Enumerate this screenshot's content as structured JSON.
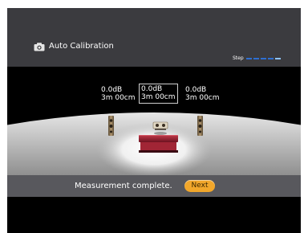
{
  "header": {
    "title": "Auto Calibration",
    "title_icon": "microphone-box-icon",
    "step_label": "Step",
    "step": {
      "total": 5,
      "current": 5
    }
  },
  "channels": {
    "front_left": {
      "level": "0.0dB",
      "distance": "3m 00cm"
    },
    "center": {
      "level": "0.0dB",
      "distance": "3m 00cm"
    },
    "front_right": {
      "level": "0.0dB",
      "distance": "3m 00cm"
    }
  },
  "status": {
    "message": "Measurement complete",
    "message_punct": ".",
    "next_label": "Next"
  },
  "colors": {
    "accent_button": "#f2a72b",
    "step_dash": "#2e6fd1",
    "header_bg": "#3b3b3f",
    "status_bar_bg": "#58585d"
  }
}
